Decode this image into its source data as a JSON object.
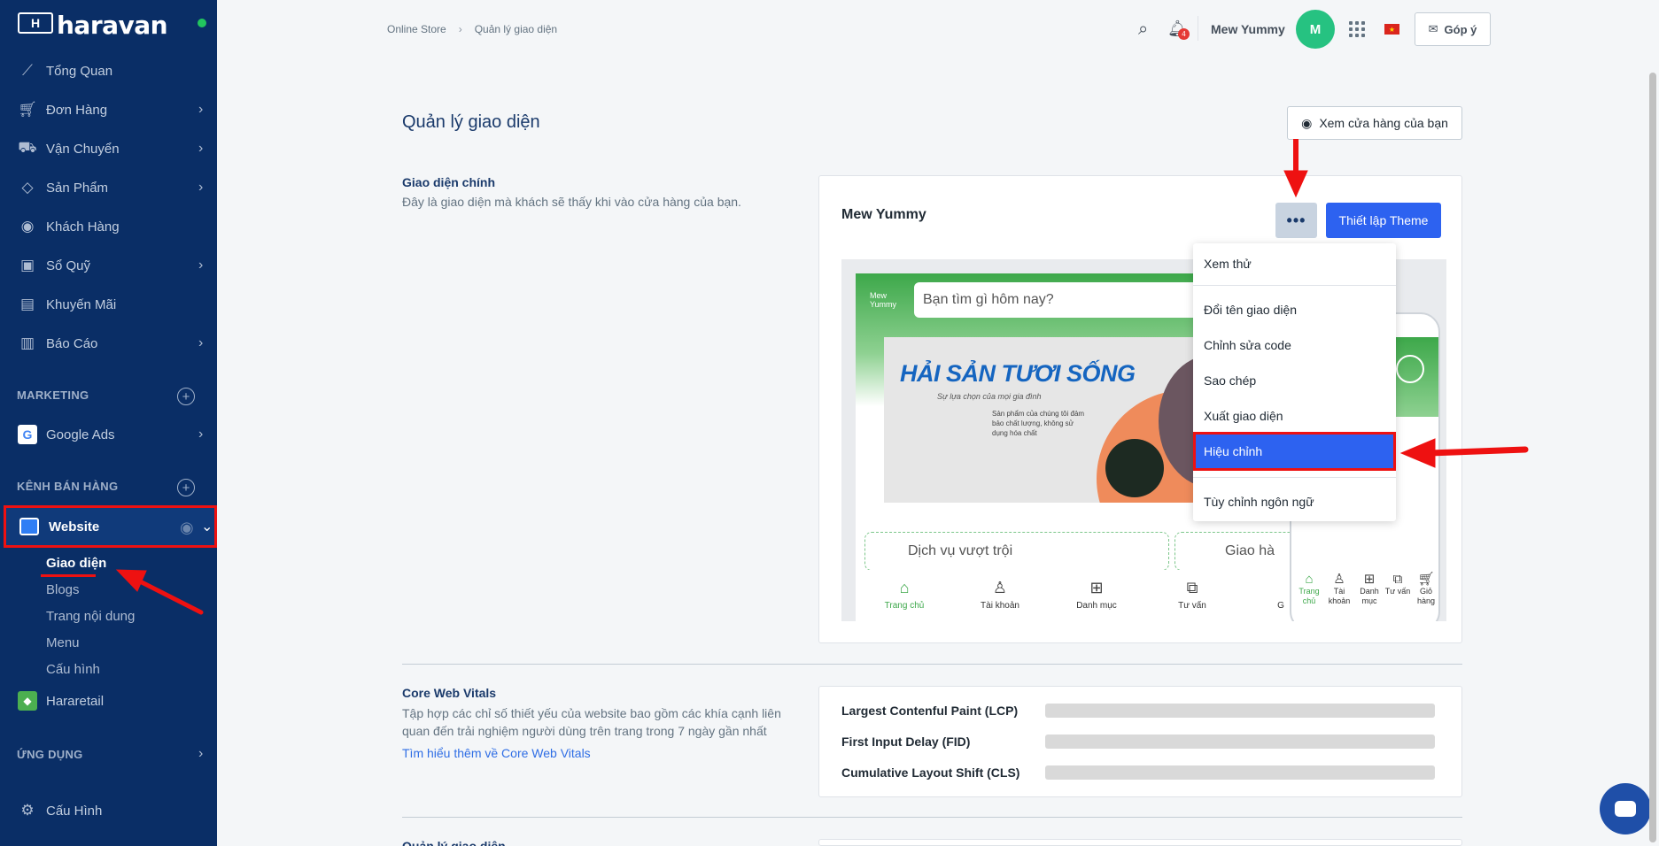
{
  "sidebar": {
    "brand": "haravan",
    "items": [
      {
        "label": "Tổng Quan",
        "icon": "trend-icon"
      },
      {
        "label": "Đơn Hàng",
        "icon": "cart-icon"
      },
      {
        "label": "Vận Chuyển",
        "icon": "truck-icon"
      },
      {
        "label": "Sản Phẩm",
        "icon": "tag-icon"
      },
      {
        "label": "Khách Hàng",
        "icon": "user-icon"
      },
      {
        "label": "Sổ Quỹ",
        "icon": "cashbook-icon"
      },
      {
        "label": "Khuyến Mãi",
        "icon": "gift-icon"
      },
      {
        "label": "Báo Cáo",
        "icon": "report-icon"
      }
    ],
    "marketing_title": "MARKETING",
    "google_ads": "Google Ads",
    "sales_channels_title": "KÊNH BÁN HÀNG",
    "website": "Website",
    "website_sub": [
      "Giao diện",
      "Blogs",
      "Trang nội dung",
      "Menu",
      "Cấu hình"
    ],
    "hararetail": "Hararetail",
    "apps_title": "ỨNG DỤNG",
    "settings": "Cấu Hình"
  },
  "header": {
    "breadcrumb": [
      "Online Store",
      "Quản lý giao diện"
    ],
    "breadcrumb_sep": "›",
    "notification_count": "4",
    "user_name": "Mew Yummy",
    "avatar_letter": "M",
    "feedback": "Góp ý"
  },
  "main": {
    "title": "Quản lý giao diện",
    "view_store": "Xem cửa hàng của bạn",
    "main_theme": {
      "title": "Giao diện chính",
      "description": "Đây là giao diện mà khách sẽ thấy khi vào cửa hàng của bạn.",
      "theme_name": "Mew Yummy",
      "more_label": "•••",
      "setup_button": "Thiết lập Theme"
    },
    "preview": {
      "logo": "Mew Yummy",
      "search_placeholder": "Bạn tìm gì hôm nay?",
      "banner_title": "HẢI SẢN TƯƠI SỐNG",
      "banner_tagline": "Sự lựa chọn của mọi gia đình",
      "banner_text": "Sản phẩm của chúng tôi đảm bảo chất lượng, không sử dụng hóa chất",
      "service_1": "Dịch vụ vượt trội",
      "service_2": "Giao hà",
      "nav": [
        "Trang chủ",
        "Tài khoản",
        "Danh mục",
        "Tư vấn",
        "G"
      ],
      "phone_nav": [
        "Trang chủ",
        "Tài khoản",
        "Danh mục",
        "Tư vấn",
        "Giỏ hàng"
      ]
    },
    "menu": {
      "items": [
        "Xem thử",
        "Đổi tên giao diện",
        "Chỉnh sửa code",
        "Sao chép",
        "Xuất giao diện",
        "Hiệu chỉnh",
        "Tùy chỉnh ngôn ngữ"
      ]
    },
    "cwv": {
      "title": "Core Web Vitals",
      "description": "Tập hợp các chỉ số thiết yếu của website bao gồm các khía cạnh liên quan đến trải nghiệm người dùng trên trang trong 7 ngày gần nhất",
      "link": "Tìm hiểu thêm về Core Web Vitals",
      "metrics": [
        "Largest Contenful Paint (LCP)",
        "First Input Delay (FID)",
        "Cumulative Layout Shift (CLS)"
      ]
    },
    "next_section": "Quản lý giao diện"
  },
  "colors": {
    "sidebar": "#0a2e66",
    "primary": "#2d62f0",
    "annotation": "#ee1111",
    "preview_green": "#3da84a"
  }
}
